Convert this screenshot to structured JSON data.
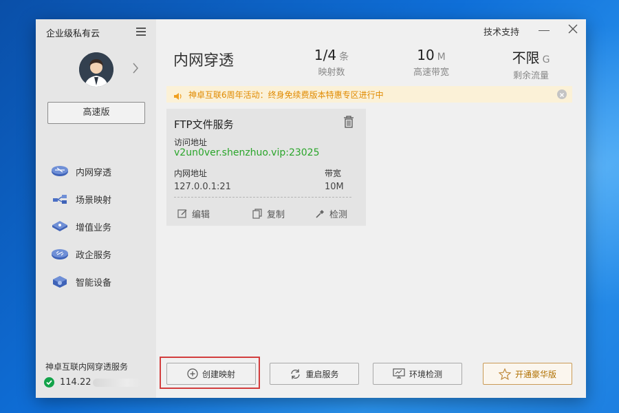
{
  "sidebar": {
    "title": "企业级私有云",
    "plan_button": "高速版",
    "nav": [
      {
        "label": "内网穿透",
        "icon": "tunnel-icon"
      },
      {
        "label": "场景映射",
        "icon": "scene-mapping-icon"
      },
      {
        "label": "增值业务",
        "icon": "value-added-icon"
      },
      {
        "label": "政企服务",
        "icon": "enterprise-icon"
      },
      {
        "label": "智能设备",
        "icon": "smart-device-icon"
      }
    ],
    "service_title": "神卓互联内网穿透服务",
    "ip_prefix": "114.22"
  },
  "titlebar": {
    "tech_support": "技术支持"
  },
  "header": {
    "title": "内网穿透",
    "stats": [
      {
        "value": "1/4",
        "unit": "条",
        "label": "映射数"
      },
      {
        "value": "10",
        "unit": "M",
        "label": "高速带宽"
      },
      {
        "value": "不限",
        "unit": "G",
        "label": "剩余流量"
      }
    ]
  },
  "banner": {
    "text": "神卓互联6周年活动：终身免续费版本特惠专区进行中"
  },
  "card": {
    "title": "FTP文件服务",
    "access_label": "访问地址",
    "access_url": "v2un0ver.shenzhuo.vip:23025",
    "lan_label": "内网地址",
    "lan_address": "127.0.0.1:21",
    "bandwidth_label": "带宽",
    "bandwidth": "10M",
    "actions": [
      "编辑",
      "复制",
      "检测"
    ]
  },
  "bottom": {
    "create": "创建映射",
    "restart": "重启服务",
    "env_check": "环境检测",
    "premium": "开通豪华版"
  },
  "colors": {
    "accent_green": "#2aa52a",
    "banner_text": "#e08a00",
    "highlight_box": "#d23c3c"
  }
}
